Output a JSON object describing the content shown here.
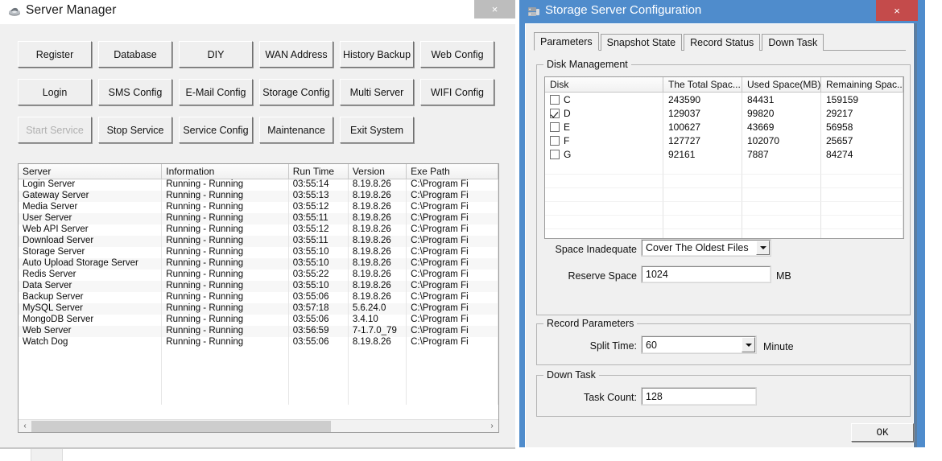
{
  "server_manager": {
    "title": "Server Manager",
    "icon": "server-app-icon",
    "close_label": "×",
    "buttons": [
      {
        "label": "Register",
        "disabled": false
      },
      {
        "label": "Database",
        "disabled": false
      },
      {
        "label": "DIY",
        "disabled": false
      },
      {
        "label": "WAN Address",
        "disabled": false
      },
      {
        "label": "History Backup",
        "disabled": false
      },
      {
        "label": "Web Config",
        "disabled": false
      },
      {
        "label": "Login",
        "disabled": false
      },
      {
        "label": "SMS Config",
        "disabled": false
      },
      {
        "label": "E-Mail Config",
        "disabled": false
      },
      {
        "label": "Storage Config",
        "disabled": false
      },
      {
        "label": "Multi Server",
        "disabled": false
      },
      {
        "label": "WIFI Config",
        "disabled": false
      },
      {
        "label": "Start Service",
        "disabled": true
      },
      {
        "label": "Stop Service",
        "disabled": false
      },
      {
        "label": "Service Config",
        "disabled": false
      },
      {
        "label": "Maintenance",
        "disabled": false
      },
      {
        "label": "Exit System",
        "disabled": false
      }
    ],
    "list": {
      "columns": [
        "Server",
        "Information",
        "Run Time",
        "Version",
        "Exe Path"
      ],
      "rows": [
        [
          "Login Server",
          "Running - Running",
          "03:55:14",
          "8.19.8.26",
          "C:\\Program Fi"
        ],
        [
          "Gateway Server",
          "Running - Running",
          "03:55:13",
          "8.19.8.26",
          "C:\\Program Fi"
        ],
        [
          "Media Server",
          "Running - Running",
          "03:55:12",
          "8.19.8.26",
          "C:\\Program Fi"
        ],
        [
          "User Server",
          "Running - Running",
          "03:55:11",
          "8.19.8.26",
          "C:\\Program Fi"
        ],
        [
          "Web API Server",
          "Running - Running",
          "03:55:12",
          "8.19.8.26",
          "C:\\Program Fi"
        ],
        [
          "Download Server",
          "Running - Running",
          "03:55:11",
          "8.19.8.26",
          "C:\\Program Fi"
        ],
        [
          "Storage Server",
          "Running - Running",
          "03:55:10",
          "8.19.8.26",
          "C:\\Program Fi"
        ],
        [
          "Auto Upload Storage Server",
          "Running - Running",
          "03:55:10",
          "8.19.8.26",
          "C:\\Program Fi"
        ],
        [
          "Redis Server",
          "Running - Running",
          "03:55:22",
          "8.19.8.26",
          "C:\\Program Fi"
        ],
        [
          "Data Server",
          "Running - Running",
          "03:55:10",
          "8.19.8.26",
          "C:\\Program Fi"
        ],
        [
          "Backup Server",
          "Running - Running",
          "03:55:06",
          "8.19.8.26",
          "C:\\Program Fi"
        ],
        [
          "MySQL Server",
          "Running - Running",
          "03:57:18",
          "5.6.24.0",
          "C:\\Program Fi"
        ],
        [
          "MongoDB Server",
          "Running - Running",
          "03:55:06",
          "3.4.10",
          "C:\\Program Fi"
        ],
        [
          "Web Server",
          "Running - Running",
          "03:56:59",
          "7-1.7.0_79",
          "C:\\Program Fi"
        ],
        [
          "Watch Dog",
          "Running - Running",
          "03:55:06",
          "8.19.8.26",
          "C:\\Program Fi"
        ]
      ],
      "scrollbar": {
        "left_arrow": "‹",
        "right_arrow": "›"
      }
    }
  },
  "storage_config": {
    "title": "Storage Server Configuration",
    "icon": "storage-app-icon",
    "close_label": "×",
    "tabs": [
      {
        "label": "Parameters",
        "active": true
      },
      {
        "label": "Snapshot State",
        "active": false
      },
      {
        "label": "Record Status",
        "active": false
      },
      {
        "label": "Down Task",
        "active": false
      }
    ],
    "disk_management": {
      "group_label": "Disk Management",
      "columns": [
        "Disk",
        "The Total Spac...",
        "Used Space(MB)",
        "Remaining Spac..."
      ],
      "rows": [
        {
          "checked": false,
          "disk": "C",
          "total": "243590",
          "used": "84431",
          "remaining": "159159"
        },
        {
          "checked": true,
          "disk": "D",
          "total": "129037",
          "used": "99820",
          "remaining": "29217"
        },
        {
          "checked": false,
          "disk": "E",
          "total": "100627",
          "used": "43669",
          "remaining": "56958"
        },
        {
          "checked": false,
          "disk": "F",
          "total": "127727",
          "used": "102070",
          "remaining": "25657"
        },
        {
          "checked": false,
          "disk": "G",
          "total": "92161",
          "used": "7887",
          "remaining": "84274"
        }
      ],
      "space_inadequate_label": "Space Inadequate",
      "space_inadequate_value": "Cover The Oldest Files",
      "space_inadequate_options": [
        "Cover The Oldest Files"
      ],
      "reserve_space_label": "Reserve Space",
      "reserve_space_value": "1024",
      "reserve_space_unit": "MB"
    },
    "record_parameters": {
      "group_label": "Record Parameters",
      "split_time_label": "Split Time:",
      "split_time_value": "60",
      "split_time_options": [
        "60"
      ],
      "split_time_unit": "Minute"
    },
    "down_task": {
      "group_label": "Down Task",
      "task_count_label": "Task Count:",
      "task_count_value": "128"
    },
    "ok_label": "OK"
  },
  "colors": {
    "accent_titlebar": "#4f8ccc",
    "close_red": "#c44b4b",
    "inactive_close": "#bdbdbd",
    "window_face": "#f0f0f0"
  }
}
